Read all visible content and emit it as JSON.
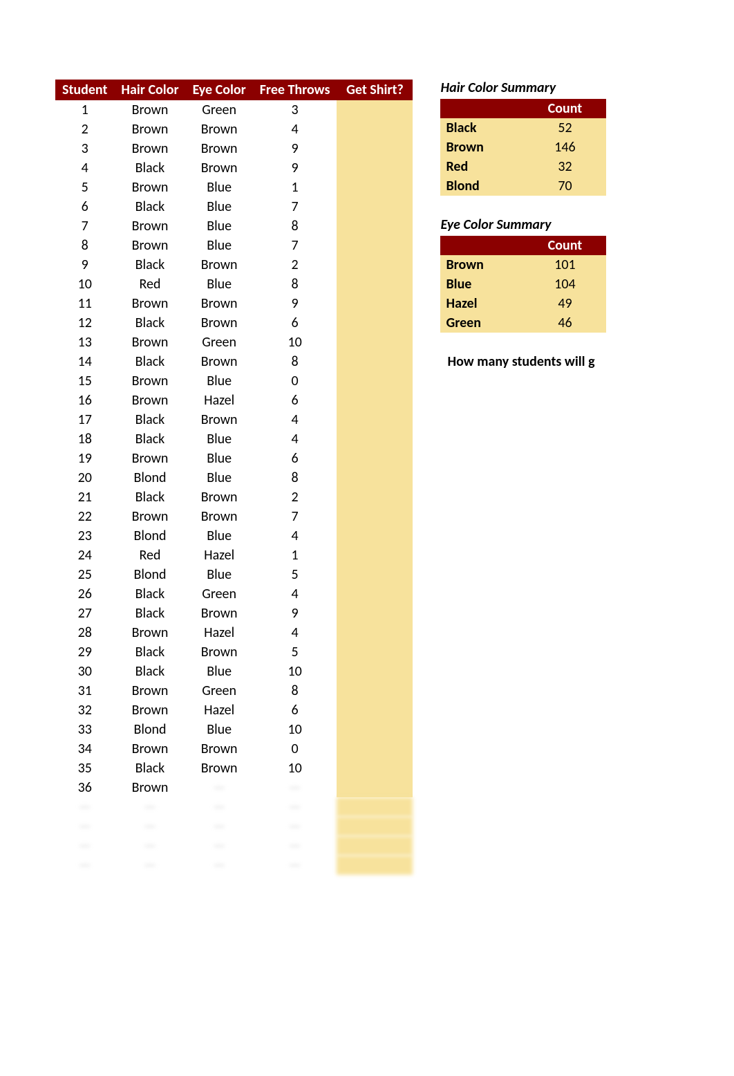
{
  "main": {
    "headers": [
      "Student",
      "Hair Color",
      "Eye Color",
      "Free Throws",
      "Get Shirt?"
    ],
    "rows": [
      {
        "student": 1,
        "hair": "Brown",
        "eye": "Green",
        "ft": 3
      },
      {
        "student": 2,
        "hair": "Brown",
        "eye": "Brown",
        "ft": 4
      },
      {
        "student": 3,
        "hair": "Brown",
        "eye": "Brown",
        "ft": 9
      },
      {
        "student": 4,
        "hair": "Black",
        "eye": "Brown",
        "ft": 9
      },
      {
        "student": 5,
        "hair": "Brown",
        "eye": "Blue",
        "ft": 1
      },
      {
        "student": 6,
        "hair": "Black",
        "eye": "Blue",
        "ft": 7
      },
      {
        "student": 7,
        "hair": "Brown",
        "eye": "Blue",
        "ft": 8
      },
      {
        "student": 8,
        "hair": "Brown",
        "eye": "Blue",
        "ft": 7
      },
      {
        "student": 9,
        "hair": "Black",
        "eye": "Brown",
        "ft": 2
      },
      {
        "student": 10,
        "hair": "Red",
        "eye": "Blue",
        "ft": 8
      },
      {
        "student": 11,
        "hair": "Brown",
        "eye": "Brown",
        "ft": 9
      },
      {
        "student": 12,
        "hair": "Black",
        "eye": "Brown",
        "ft": 6
      },
      {
        "student": 13,
        "hair": "Brown",
        "eye": "Green",
        "ft": 10
      },
      {
        "student": 14,
        "hair": "Black",
        "eye": "Brown",
        "ft": 8
      },
      {
        "student": 15,
        "hair": "Brown",
        "eye": "Blue",
        "ft": 0
      },
      {
        "student": 16,
        "hair": "Brown",
        "eye": "Hazel",
        "ft": 6
      },
      {
        "student": 17,
        "hair": "Black",
        "eye": "Brown",
        "ft": 4
      },
      {
        "student": 18,
        "hair": "Black",
        "eye": "Blue",
        "ft": 4
      },
      {
        "student": 19,
        "hair": "Brown",
        "eye": "Blue",
        "ft": 6
      },
      {
        "student": 20,
        "hair": "Blond",
        "eye": "Blue",
        "ft": 8
      },
      {
        "student": 21,
        "hair": "Black",
        "eye": "Brown",
        "ft": 2
      },
      {
        "student": 22,
        "hair": "Brown",
        "eye": "Brown",
        "ft": 7
      },
      {
        "student": 23,
        "hair": "Blond",
        "eye": "Blue",
        "ft": 4
      },
      {
        "student": 24,
        "hair": "Red",
        "eye": "Hazel",
        "ft": 1
      },
      {
        "student": 25,
        "hair": "Blond",
        "eye": "Blue",
        "ft": 5
      },
      {
        "student": 26,
        "hair": "Black",
        "eye": "Green",
        "ft": 4
      },
      {
        "student": 27,
        "hair": "Black",
        "eye": "Brown",
        "ft": 9
      },
      {
        "student": 28,
        "hair": "Brown",
        "eye": "Hazel",
        "ft": 4
      },
      {
        "student": 29,
        "hair": "Black",
        "eye": "Brown",
        "ft": 5
      },
      {
        "student": 30,
        "hair": "Black",
        "eye": "Blue",
        "ft": 10
      },
      {
        "student": 31,
        "hair": "Brown",
        "eye": "Green",
        "ft": 8
      },
      {
        "student": 32,
        "hair": "Brown",
        "eye": "Hazel",
        "ft": 6
      },
      {
        "student": 33,
        "hair": "Blond",
        "eye": "Blue",
        "ft": 10
      },
      {
        "student": 34,
        "hair": "Brown",
        "eye": "Brown",
        "ft": 0
      },
      {
        "student": 35,
        "hair": "Black",
        "eye": "Brown",
        "ft": 10
      },
      {
        "student": 36,
        "hair": "Brown",
        "eye": "",
        "ft": ""
      }
    ]
  },
  "hair_summary": {
    "title": "Hair Color Summary",
    "count_label": "Count",
    "rows": [
      {
        "label": "Black",
        "value": 52
      },
      {
        "label": "Brown",
        "value": 146
      },
      {
        "label": "Red",
        "value": 32
      },
      {
        "label": "Blond",
        "value": 70
      }
    ]
  },
  "eye_summary": {
    "title": "Eye Color Summary",
    "count_label": "Count",
    "rows": [
      {
        "label": "Brown",
        "value": 101
      },
      {
        "label": "Blue",
        "value": 104
      },
      {
        "label": "Hazel",
        "value": 49
      },
      {
        "label": "Green",
        "value": 46
      }
    ]
  },
  "question": "How many students will g"
}
